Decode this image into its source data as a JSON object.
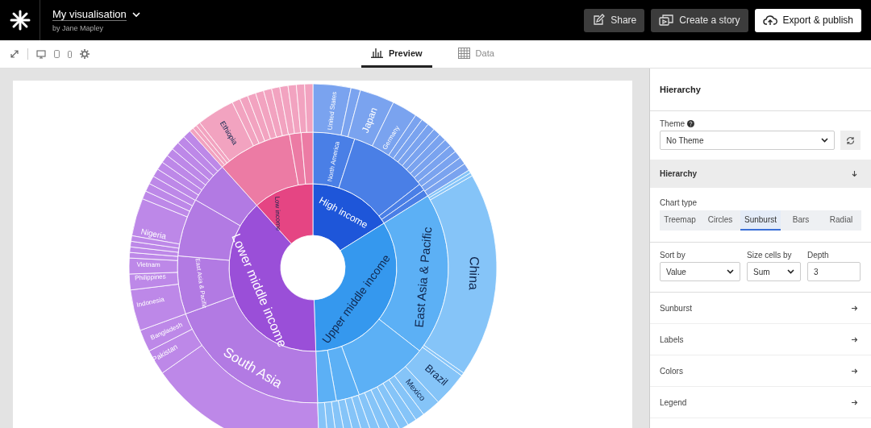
{
  "app": {
    "title": "My visualisation",
    "author": "by Jane Mapley"
  },
  "actions": [
    {
      "label": "Share",
      "kind": "share"
    },
    {
      "label": "Create a story",
      "kind": "story"
    },
    {
      "label": "Export & publish",
      "kind": "export"
    }
  ],
  "view_tabs": [
    {
      "label": "Preview",
      "selected": true,
      "kind": "preview"
    },
    {
      "label": "Data",
      "selected": false,
      "kind": "data"
    }
  ],
  "chart": {
    "labels": [
      "High income",
      "Upper middle income",
      "Lower middle income",
      "Low income",
      "East Asia & Pacific",
      "South Asia",
      "East Asia & Pacific",
      "North America",
      "China",
      "Brazil",
      "Mexico",
      "United States",
      "Japan",
      "Germany",
      "Nigeria",
      "Vietnam",
      "Philippines",
      "Indonesia",
      "Bangladesh",
      "Pakistan",
      "Ethiopia"
    ]
  },
  "panel": {
    "title": "Hierarchy",
    "theme": {
      "label": "Theme",
      "value": "No Theme"
    },
    "section": {
      "title": "Hierarchy",
      "expanded": true
    },
    "chart_type": {
      "label": "Chart type",
      "options": [
        {
          "label": "Treemap",
          "selected": false
        },
        {
          "label": "Circles",
          "selected": false
        },
        {
          "label": "Sunburst",
          "selected": true
        },
        {
          "label": "Bars",
          "selected": false
        },
        {
          "label": "Radial",
          "selected": false
        }
      ]
    },
    "fields": [
      {
        "label": "Sort by",
        "value": "Value",
        "kind": "select"
      },
      {
        "label": "Size cells by",
        "value": "Sum",
        "kind": "select"
      },
      {
        "label": "Depth",
        "value": "3",
        "kind": "number"
      }
    ],
    "sections": [
      {
        "title": "Sunburst",
        "expanded": false
      },
      {
        "title": "Labels",
        "expanded": false
      },
      {
        "title": "Colors",
        "expanded": false
      },
      {
        "title": "Legend",
        "expanded": false
      }
    ]
  }
}
